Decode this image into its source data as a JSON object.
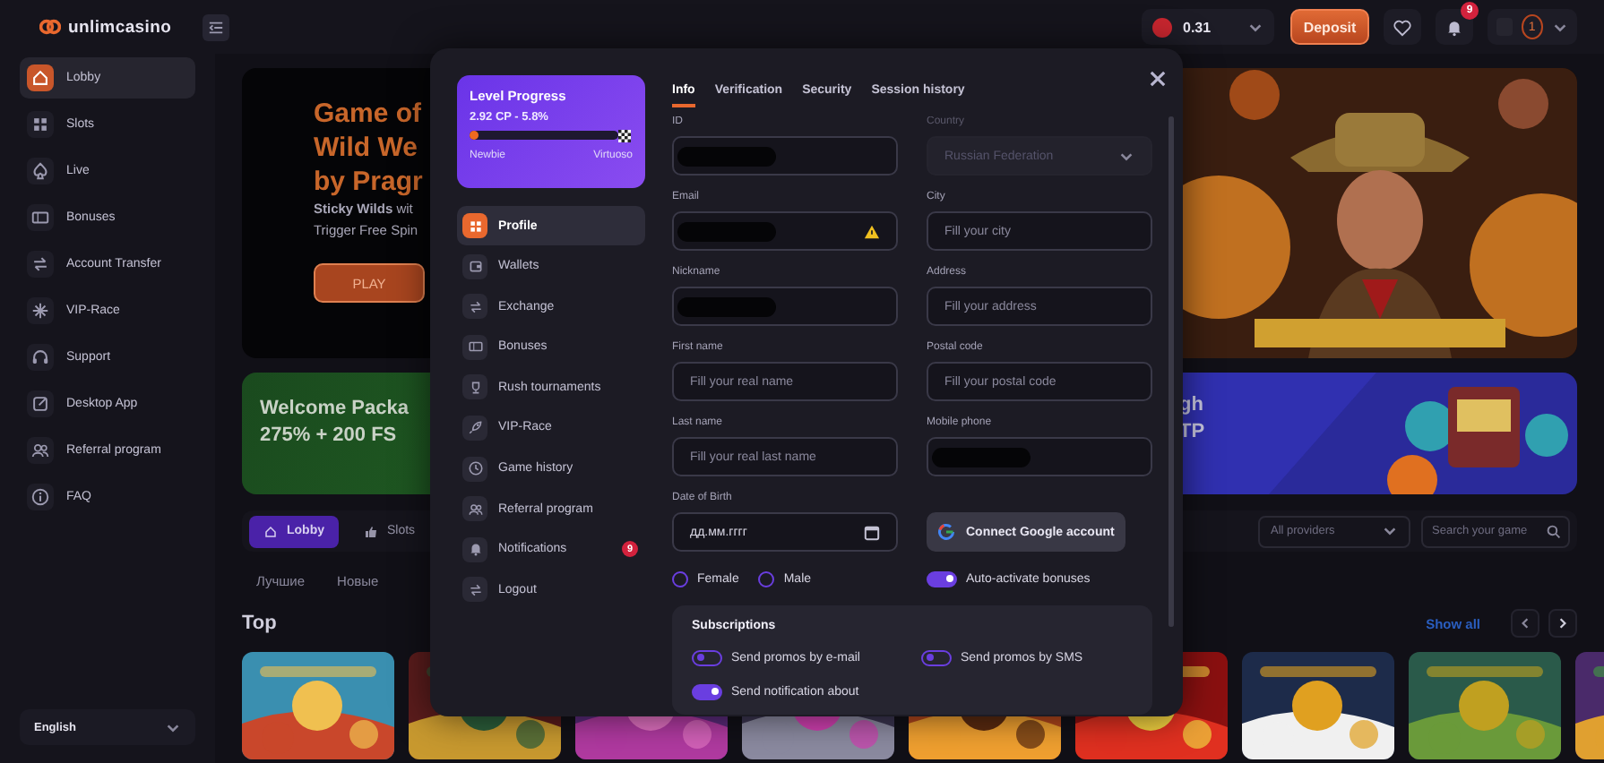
{
  "header": {
    "logo": "unlimcasino",
    "balance": "0.31",
    "deposit": "Deposit",
    "notifications_badge": "9",
    "level": "1"
  },
  "sidebar": {
    "items": [
      {
        "label": "Lobby",
        "selected": true
      },
      {
        "label": "Slots",
        "selected": false
      },
      {
        "label": "Live",
        "selected": false
      },
      {
        "label": "Bonuses",
        "selected": false
      },
      {
        "label": "Account Transfer",
        "selected": false
      },
      {
        "label": "VIP-Race",
        "selected": false
      },
      {
        "label": "Support",
        "selected": false
      },
      {
        "label": "Desktop App",
        "selected": false
      },
      {
        "label": "Referral program",
        "selected": false
      },
      {
        "label": "FAQ",
        "selected": false
      }
    ],
    "language": "English"
  },
  "main": {
    "banner": {
      "headline": [
        "Game of",
        "Wild We",
        "by Pragr"
      ],
      "lines": [
        "**Sticky Wilds** wit",
        "Trigger Free Spin"
      ],
      "button": "PLAY"
    },
    "promo_left": {
      "lines": [
        "Welcome Packa",
        "275% + 200 FS"
      ]
    },
    "promo_right": {
      "lines": [
        "gh",
        "TP"
      ]
    },
    "tabs": [
      {
        "label": "Lobby",
        "selected": true
      },
      {
        "label": "Slots",
        "selected": false
      }
    ],
    "providers": "All providers",
    "search": {
      "placeholder": "Search your game"
    },
    "categories": [
      "Лучшие",
      "Новые"
    ],
    "section_title": "Top",
    "show_all": "Show all",
    "games": [
      {
        "kind": "picture"
      },
      {
        "kind": "picture"
      },
      {
        "kind": "picture"
      },
      {
        "kind": "picture"
      },
      {
        "kind": "picture"
      },
      {
        "kind": "picture"
      },
      {
        "kind": "picture"
      },
      {
        "kind": "picture"
      },
      {
        "kind": "picture"
      }
    ]
  },
  "modal": {
    "level_card": {
      "title": "Level Progress",
      "progress": "2.92 CP - 5.8%",
      "level": 0.058,
      "from": "Newbie",
      "to": "Virtuoso"
    },
    "menu": [
      {
        "label": "Profile",
        "selected": true
      },
      {
        "label": "Wallets",
        "selected": false
      },
      {
        "label": "Exchange",
        "selected": false
      },
      {
        "label": "Bonuses",
        "selected": false
      },
      {
        "label": "Rush tournaments",
        "selected": false
      },
      {
        "label": "VIP-Race",
        "selected": false
      },
      {
        "label": "Game history",
        "selected": false
      },
      {
        "label": "Referral program",
        "selected": false
      },
      {
        "label": "Notifications",
        "selected": false,
        "badge": "9"
      },
      {
        "label": "Logout",
        "selected": false
      }
    ],
    "tabs": [
      {
        "label": "Info",
        "selected": true
      },
      {
        "label": "Verification",
        "selected": false
      },
      {
        "label": "Security",
        "selected": false
      },
      {
        "label": "Session history",
        "selected": false
      }
    ],
    "fields": [
      {
        "kind": "text",
        "label": "ID",
        "redacted": true
      },
      {
        "kind": "select",
        "label": "Country",
        "value": "Russian Federation",
        "disabled": true
      },
      {
        "kind": "text",
        "label": "Email",
        "redacted": true,
        "warning": true
      },
      {
        "kind": "text",
        "label": "City",
        "placeholder": "Fill your city"
      },
      {
        "kind": "text",
        "label": "Nickname",
        "redacted": true
      },
      {
        "kind": "text",
        "label": "Address",
        "placeholder": "Fill your address"
      },
      {
        "kind": "text",
        "label": "First name",
        "placeholder": "Fill your real name"
      },
      {
        "kind": "text",
        "label": "Postal code",
        "placeholder": "Fill your postal code"
      },
      {
        "kind": "text",
        "label": "Last name",
        "placeholder": "Fill your real last name"
      },
      {
        "kind": "text",
        "label": "Mobile phone",
        "redacted": true
      },
      {
        "kind": "date",
        "label": "Date of Birth",
        "value": "дд.мм.гггг"
      },
      {
        "kind": "google",
        "label": "Connect Google account"
      }
    ],
    "gender": [
      {
        "label": "Female",
        "selected": false
      },
      {
        "label": "Male",
        "selected": false
      }
    ],
    "auto_bonuses": {
      "label": "Auto-activate bonuses",
      "on": true
    },
    "subscriptions": {
      "title": "Subscriptions",
      "items": [
        {
          "label": "Send promos by e-mail",
          "on": false
        },
        {
          "label": "Send promos by SMS",
          "on": false
        },
        {
          "label": "Send notification about",
          "on": true
        }
      ]
    }
  }
}
